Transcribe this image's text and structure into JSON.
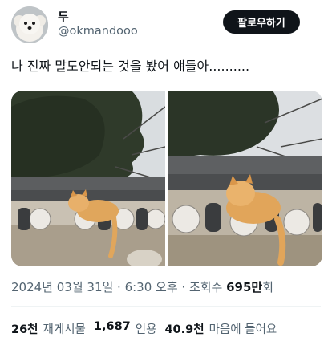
{
  "author": {
    "display_name": "두",
    "handle": "@okmandooo",
    "avatar_icon": "white-puppy-avatar"
  },
  "follow_button": {
    "label": "팔로우하기"
  },
  "tweet": {
    "text": "나 진짜 말도안되는 것을 봤어 얘들아..........",
    "media": [
      {
        "alt_icon": "cat-on-roof-tiles-photo"
      },
      {
        "alt_icon": "cat-on-roof-tiles-closeup-photo"
      }
    ]
  },
  "meta": {
    "date_time": "2024년 03월 31일 · 6:30 오후 · 조회수 ",
    "views": "695만",
    "views_suffix": "회"
  },
  "stats": {
    "retweets_count": "26천",
    "retweets_label": "재게시물",
    "quotes_count": "1,687",
    "quotes_label": "인용",
    "likes_count": "40.9천",
    "likes_label": "마음에 들어요"
  },
  "colors": {
    "text_primary": "#0f1419",
    "text_secondary": "#536471",
    "button_bg": "#0f1419",
    "divider": "#eff3f4"
  }
}
